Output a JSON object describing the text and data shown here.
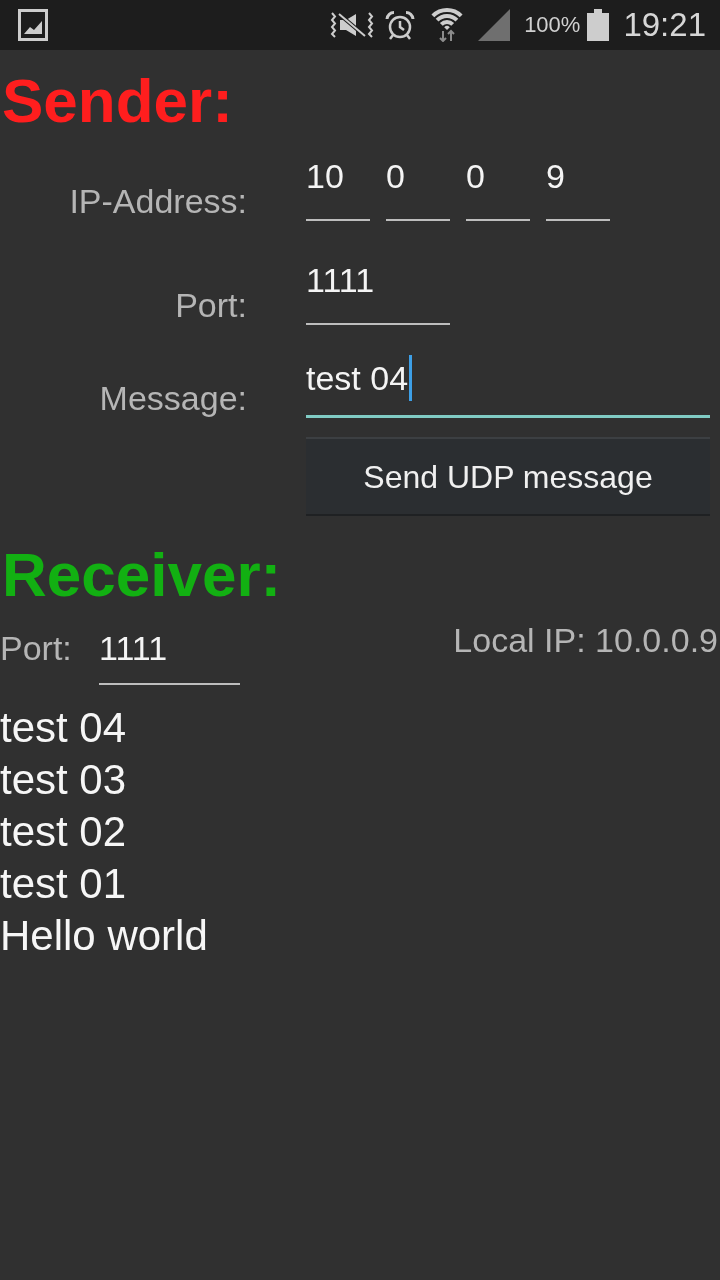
{
  "status_bar": {
    "battery": "100%",
    "time": "19:21"
  },
  "sender": {
    "title": "Sender:",
    "ip_address": {
      "label": "IP-Address:",
      "octets": [
        "10",
        "0",
        "0",
        "9"
      ]
    },
    "port": {
      "label": "Port:",
      "value": "1111"
    },
    "message": {
      "label": "Message:",
      "value": "test 04",
      "focused": true
    },
    "send_button": {
      "label": "Send UDP message"
    }
  },
  "receiver": {
    "title": "Receiver:",
    "port": {
      "label": "Port:",
      "value": "1111"
    },
    "local_ip": "Local IP: 10.0.0.9",
    "messages": [
      "test 04",
      "test 03",
      "test 02",
      "test 01",
      "Hello world"
    ]
  }
}
